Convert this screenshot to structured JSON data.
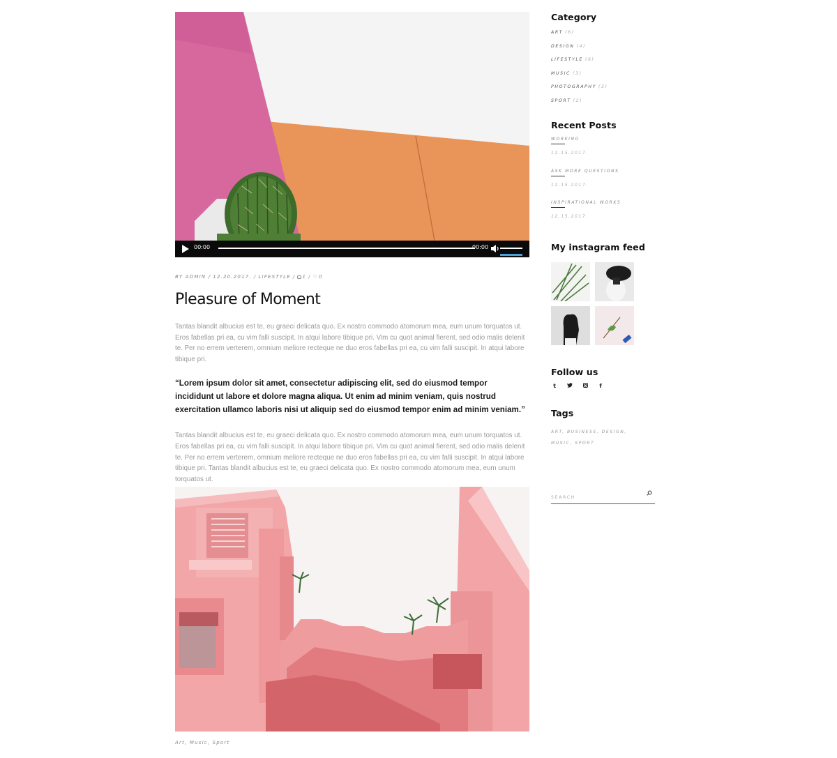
{
  "post": {
    "player": {
      "current_time": "00:00",
      "duration": "00:00",
      "progress": 0,
      "volume": 1.0
    },
    "meta": {
      "by": "BY ADMIN /",
      "date": "12.20.2017.",
      "sep1": "/",
      "category": "LIFESTYLE",
      "sep2": "/",
      "comments": "1",
      "sep3": "/",
      "likes": "0"
    },
    "title": "Pleasure of Moment",
    "paragraph1": "Tantas blandit albucius est te, eu graeci delicata quo. Ex nostro commodo atomorum mea, eum unum torquatos ut. Eros fabellas pri ea, cu vim falli suscipit. In atqui labore tibique pri. Vim cu quot animal fierent, sed odio malis delenit te. Per no errem verterem, omnium meliore recteque ne duo eros fabellas pri ea, cu vim falli suscipit. In atqui labore tibique pri.",
    "quote": "“Lorem ipsum dolor sit amet, consectetur adipiscing elit, sed do eiusmod tempor incididunt ut labore et dolore magna aliqua. Ut enim ad minim veniam, quis nostrud exercitation ullamco laboris nisi ut aliquip sed do eiusmod tempor enim ad minim veniam.”",
    "paragraph2": "Tantas blandit albucius est te, eu graeci delicata quo. Ex nostro commodo atomorum mea, eum unum torquatos ut. Eros fabellas pri ea, cu vim falli suscipit. In atqui labore tibique pri. Vim cu quot animal fierent, sed odio malis delenit te. Per no errem verterem, omnium meliore recteque ne duo eros fabellas pri ea, cu vim falli suscipit. In atqui labore tibique pri. Tantas blandit albucius est te, eu graeci delicata quo. Ex nostro commodo atomorum mea, eum unum torquatos ut."
  },
  "next_post": {
    "tags": "Art, Music, Sport"
  },
  "sidebar": {
    "category": {
      "title": "Category",
      "items": [
        {
          "label": "ART",
          "count": "(6)"
        },
        {
          "label": "DESIGN",
          "count": "(4)"
        },
        {
          "label": "LIFESTYLE",
          "count": "(6)"
        },
        {
          "label": "MUSIC",
          "count": "(3)"
        },
        {
          "label": "PHOTOGRAPHY",
          "count": "(3)"
        },
        {
          "label": "SPORT",
          "count": "(2)"
        }
      ]
    },
    "recent_posts": {
      "title": "Recent Posts",
      "items": [
        {
          "title": "WORKING",
          "date": "12.15.2017."
        },
        {
          "title": "ASK MORE QUESTIONS",
          "date": "12.15.2017."
        },
        {
          "title": "INSPIRATIONAL WORKS",
          "date": "12.15.2017."
        }
      ]
    },
    "instagram": {
      "title": "My instagram feed"
    },
    "follow": {
      "title": "Follow us",
      "icons": [
        "tumblr-icon",
        "twitter-icon",
        "instagram-icon",
        "facebook-icon"
      ],
      "glyphs": [
        "t",
        "🐦",
        "◙",
        "f"
      ]
    },
    "tags": {
      "title": "Tags",
      "text": "ART, BUSINESS, DESIGN, MUSIC, SPORT"
    },
    "search": {
      "placeholder": "SEARCH"
    }
  },
  "colors": {
    "accent": "#4a9fd8",
    "text": "#111111",
    "muted": "#9a9a9a"
  }
}
